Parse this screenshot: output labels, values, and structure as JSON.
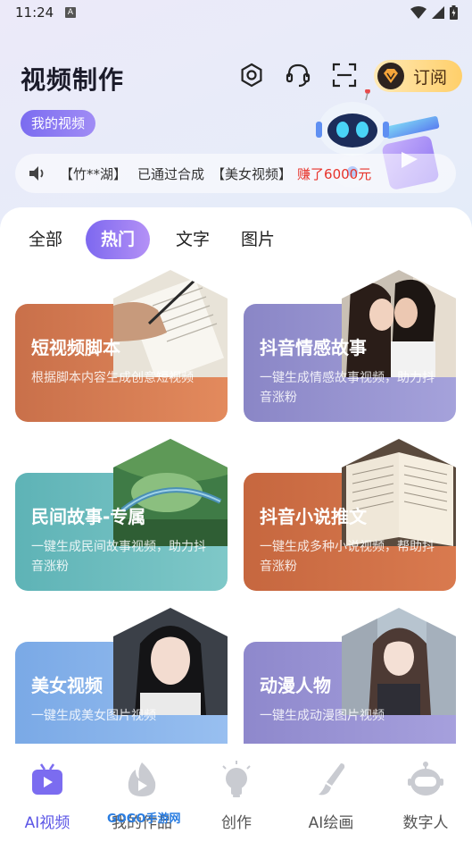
{
  "status_bar": {
    "time": "11:24",
    "a_icon": "A"
  },
  "header": {
    "title": "视频制作",
    "my_videos": "我的视频",
    "subscribe": "订阅",
    "icons": [
      "settings-hex-icon",
      "headset-icon",
      "scan-icon"
    ]
  },
  "notice": {
    "user": "【竹**湖】",
    "passed": "已通过合成",
    "video": "【美女视频】",
    "earn": "赚了6000元"
  },
  "tabs": [
    "全部",
    "热门",
    "文字",
    "图片"
  ],
  "active_tab": "热门",
  "cards": [
    {
      "title": "短视频脚本",
      "desc": "根据脚本内容生成创意短视频",
      "color": "#d47a50"
    },
    {
      "title": "抖音情感故事",
      "desc": "一键生成情感故事视频，助力抖音涨粉",
      "color": "#9894d0"
    },
    {
      "title": "民间故事-专属",
      "desc": "一键生成民间故事视频，助力抖音涨粉",
      "color": "#6dbdbe"
    },
    {
      "title": "抖音小说推文",
      "desc": "一键生成多种小说视频，帮助抖音涨粉",
      "color": "#cf7750"
    },
    {
      "title": "美女视频",
      "desc": "一键生成美女图片视频",
      "color": "#88b3ea"
    },
    {
      "title": "动漫人物",
      "desc": "一键生成动漫图片视频",
      "color": "#9a94d4"
    }
  ],
  "nav": [
    {
      "label": "AI视频",
      "icon": "tv-icon",
      "active": true
    },
    {
      "label": "我的作品",
      "icon": "flame-play-icon",
      "active": false
    },
    {
      "label": "创作",
      "icon": "lightbulb-icon",
      "active": false
    },
    {
      "label": "AI绘画",
      "icon": "brush-icon",
      "active": false
    },
    {
      "label": "数字人",
      "icon": "robot-head-icon",
      "active": false
    }
  ],
  "watermark": "GOGO手游网",
  "colors": {
    "accent": "#7b6cf0",
    "earn": "#e7332a",
    "nav_active": "#5b55e6"
  }
}
